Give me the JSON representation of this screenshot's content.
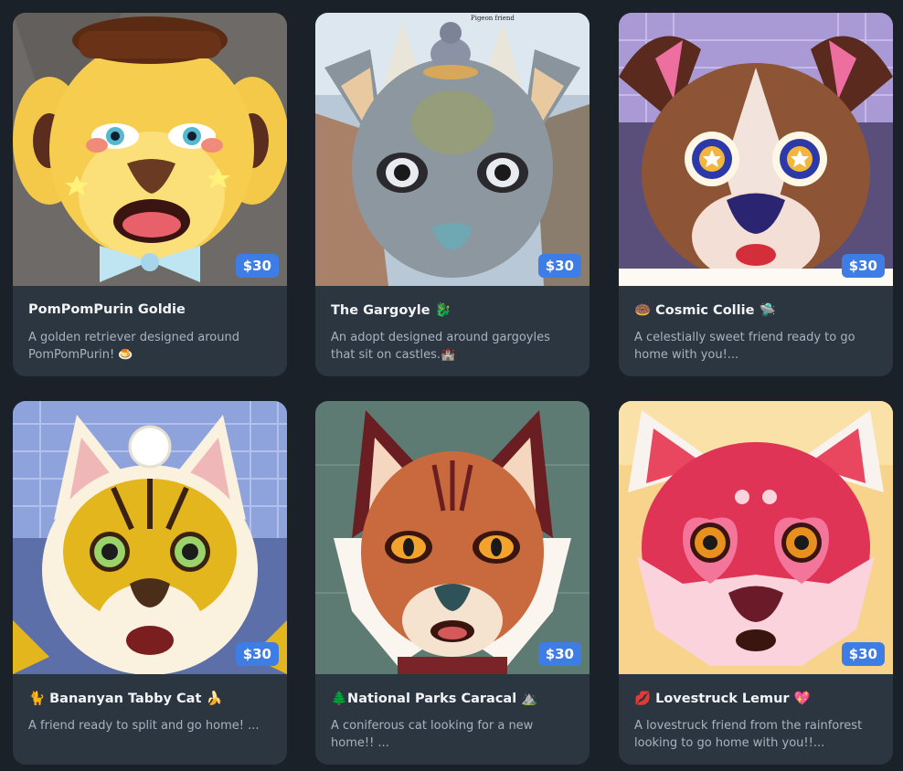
{
  "cards": [
    {
      "title": "PomPomPurin Goldie",
      "desc": "A golden retriever designed around PomPomPurin! 🍮",
      "price": "$30"
    },
    {
      "title": "The Gargoyle 🐉",
      "desc": "An adopt designed around gargoyles that sit on castles.🏰",
      "price": "$30",
      "art_text": "Pigeon friend"
    },
    {
      "title": "🍩 Cosmic Collie 🛸",
      "desc": "A celestially sweet friend ready to go home with you!...",
      "price": "$30"
    },
    {
      "title": "🐈 Bananyan Tabby Cat 🍌",
      "desc": "A friend ready to split and go home! ...",
      "price": "$30"
    },
    {
      "title": "🌲National Parks Caracal ⛰️",
      "desc": "A coniferous cat looking for a new home!! ...",
      "price": "$30"
    },
    {
      "title": "💋 Lovestruck Lemur 💖",
      "desc": "A lovestruck friend from the rainforest looking to go home with you!!...",
      "price": "$30"
    }
  ]
}
